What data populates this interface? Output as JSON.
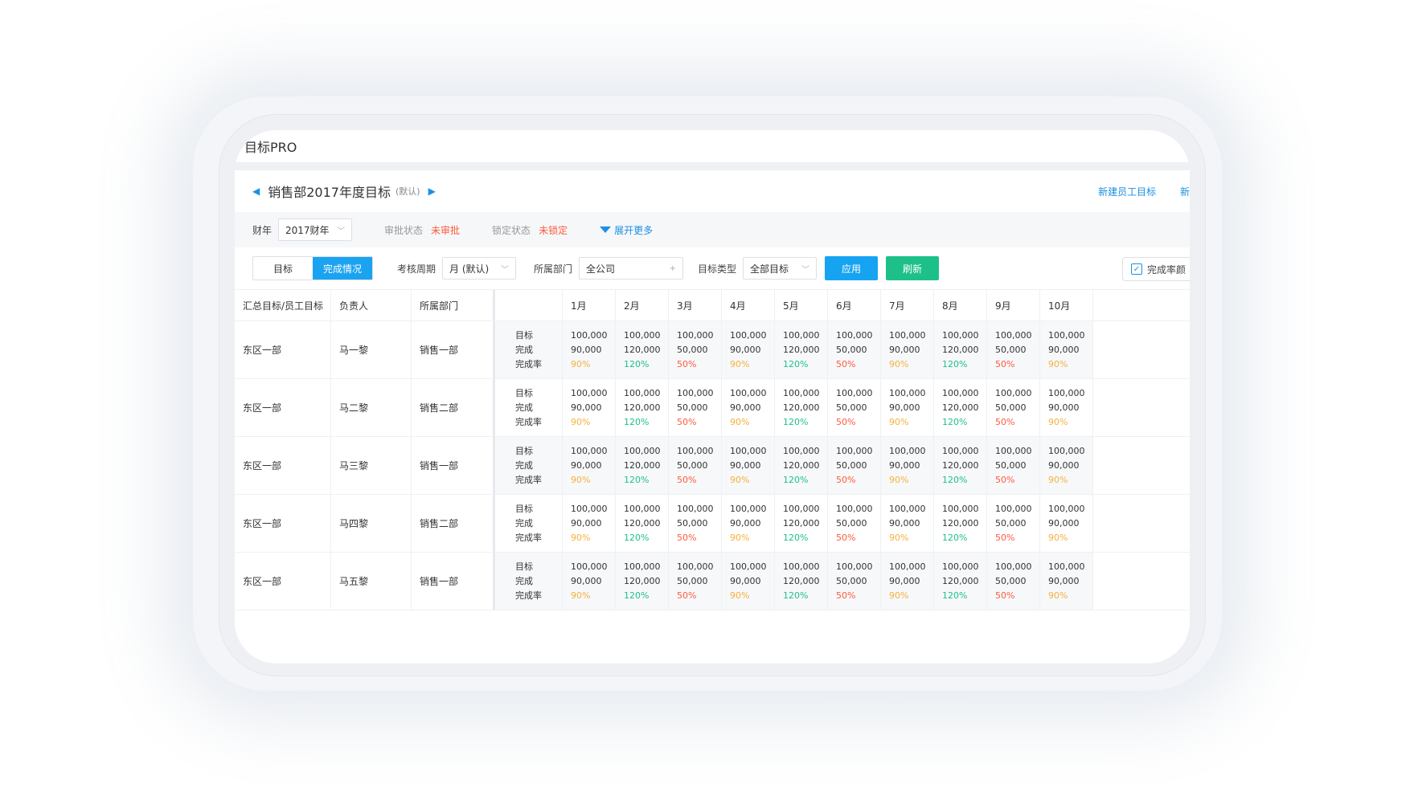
{
  "app_title": "目标PRO",
  "header": {
    "title": "销售部2017年度目标",
    "tag": "(默认)",
    "new_employee_goal": "新建员工目标",
    "new_more": "新"
  },
  "filters": {
    "fiscal_label": "财年",
    "fiscal_value": "2017财年",
    "approve_label": "审批状态",
    "approve_value": "未审批",
    "lock_label": "锁定状态",
    "lock_value": "未锁定",
    "more": "展开更多",
    "tab_goal": "目标",
    "tab_completion": "完成情况",
    "period_label": "考核周期",
    "period_value": "月 (默认)",
    "dept_label": "所属部门",
    "dept_value": "全公司",
    "type_label": "目标类型",
    "type_value": "全部目标",
    "apply": "应用",
    "refresh": "刷新",
    "completion_rate_check": "完成率颜"
  },
  "table": {
    "headers": [
      "汇总目标/员工目标",
      "负责人",
      "所属部门"
    ],
    "months": [
      "1月",
      "2月",
      "3月",
      "4月",
      "5月",
      "6月",
      "7月",
      "8月",
      "9月",
      "10月"
    ],
    "metric_labels": [
      "目标",
      "完成",
      "完成率"
    ],
    "rows": [
      {
        "group": "东区一部",
        "owner": "马一黎",
        "dept": "销售一部"
      },
      {
        "group": "东区一部",
        "owner": "马二黎",
        "dept": "销售二部"
      },
      {
        "group": "东区一部",
        "owner": "马三黎",
        "dept": "销售一部"
      },
      {
        "group": "东区一部",
        "owner": "马四黎",
        "dept": "销售二部"
      },
      {
        "group": "东区一部",
        "owner": "马五黎",
        "dept": "销售一部"
      }
    ],
    "month_values": [
      {
        "target": "100,000",
        "done": "90,000",
        "rate": "90%",
        "color": "o"
      },
      {
        "target": "100,000",
        "done": "120,000",
        "rate": "120%",
        "color": "g"
      },
      {
        "target": "100,000",
        "done": "50,000",
        "rate": "50%",
        "color": "r"
      },
      {
        "target": "100,000",
        "done": "90,000",
        "rate": "90%",
        "color": "o"
      },
      {
        "target": "100,000",
        "done": "120,000",
        "rate": "120%",
        "color": "g"
      },
      {
        "target": "100,000",
        "done": "50,000",
        "rate": "50%",
        "color": "r"
      },
      {
        "target": "100,000",
        "done": "90,000",
        "rate": "90%",
        "color": "o"
      },
      {
        "target": "100,000",
        "done": "120,000",
        "rate": "120%",
        "color": "g"
      },
      {
        "target": "100,000",
        "done": "50,000",
        "rate": "50%",
        "color": "r"
      },
      {
        "target": "100,000",
        "done": "90,000",
        "rate": "90%",
        "color": "o"
      }
    ]
  },
  "colors": {
    "accent": "#16a4f2",
    "green": "#1ec08a",
    "orange": "#f5b13d",
    "red": "#ff5a3c"
  }
}
